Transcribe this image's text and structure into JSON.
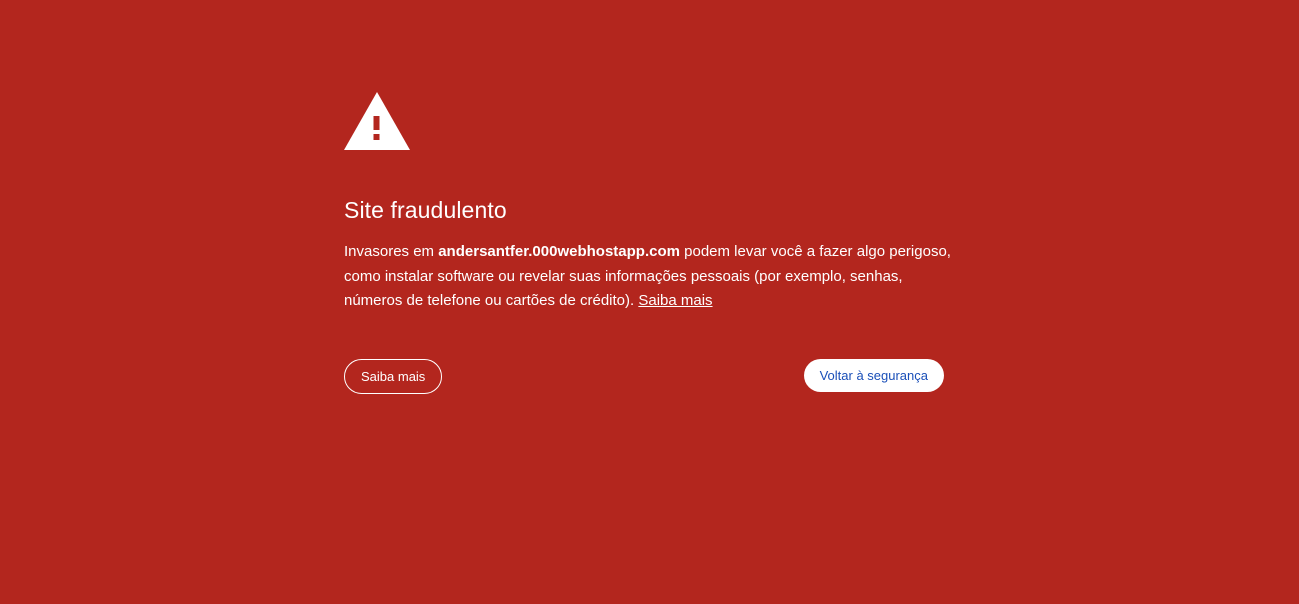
{
  "warning": {
    "icon": "warning-triangle-icon",
    "background_color": "#b3261e",
    "icon_color": "#ffffff"
  },
  "title": "Site fraudulento",
  "message": {
    "prefix": "Invasores em ",
    "domain": "andersantfer.000webhostapp.com",
    "body": " podem levar você a fazer algo perigoso, como instalar software ou revelar suas informações pessoais (por exemplo, senhas, números de telefone ou cartões de crédito). ",
    "link_text": "Saiba mais"
  },
  "buttons": {
    "learn_more_label": "Saiba mais",
    "back_to_safety_label": "Voltar à segurança",
    "back_to_safety_text_color": "#1a4fb8"
  }
}
